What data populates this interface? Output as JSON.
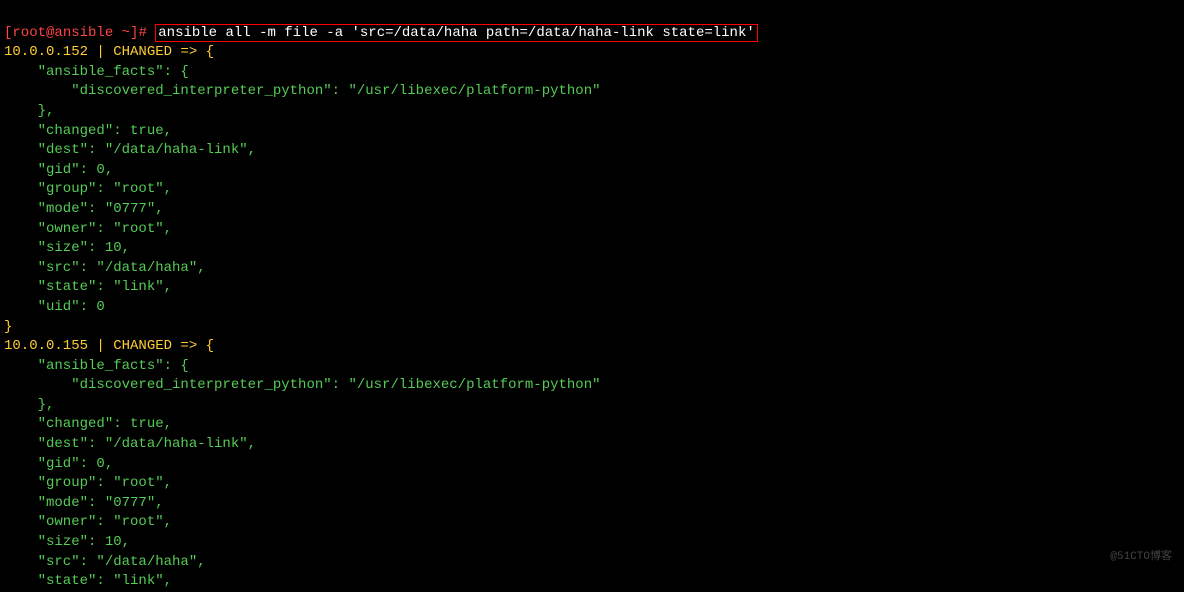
{
  "prompt": {
    "open_bracket": "[",
    "user": "root",
    "at": "@",
    "host": "ansible",
    "path": " ~",
    "close_bracket": "]",
    "hash": "# "
  },
  "command": "ansible all -m file -a 'src=/data/haha path=/data/haha-link state=link'",
  "output": {
    "host1_header": "10.0.0.152 | CHANGED => {",
    "host1_lines": [
      "    \"ansible_facts\": {",
      "        \"discovered_interpreter_python\": \"/usr/libexec/platform-python\"",
      "    },",
      "    \"changed\": true,",
      "    \"dest\": \"/data/haha-link\",",
      "    \"gid\": 0,",
      "    \"group\": \"root\",",
      "    \"mode\": \"0777\",",
      "    \"owner\": \"root\",",
      "    \"size\": 10,",
      "    \"src\": \"/data/haha\",",
      "    \"state\": \"link\",",
      "    \"uid\": 0",
      "}"
    ],
    "host2_header": "10.0.0.155 | CHANGED => {",
    "host2_lines": [
      "    \"ansible_facts\": {",
      "        \"discovered_interpreter_python\": \"/usr/libexec/platform-python\"",
      "    },",
      "    \"changed\": true,",
      "    \"dest\": \"/data/haha-link\",",
      "    \"gid\": 0,",
      "    \"group\": \"root\",",
      "    \"mode\": \"0777\",",
      "    \"owner\": \"root\",",
      "    \"size\": 10,",
      "    \"src\": \"/data/haha\",",
      "    \"state\": \"link\","
    ]
  },
  "watermark": "@51CTO博客"
}
